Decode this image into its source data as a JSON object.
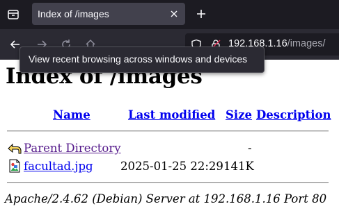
{
  "browser": {
    "tab_title": "Index of /images",
    "url_host": "192.168.1.16",
    "url_path": "/images/",
    "tooltip": "View recent browsing across windows and devices"
  },
  "page": {
    "title": "Index of /images",
    "columns": {
      "name": "Name",
      "last_modified": "Last modified",
      "size": "Size",
      "description": "Description"
    },
    "rows": [
      {
        "name": "Parent Directory",
        "last_modified": "",
        "size": "-",
        "description": "",
        "icon": "back-arrow-icon",
        "link_color": "#551a8b"
      },
      {
        "name": "facultad.jpg",
        "last_modified": "2025-01-25 22:29",
        "size": "141K",
        "description": "",
        "icon": "image-file-icon",
        "link_color": "#0000ee"
      }
    ],
    "footer": "Apache/2.4.62 (Debian) Server at 192.168.1.16 Port 80"
  }
}
